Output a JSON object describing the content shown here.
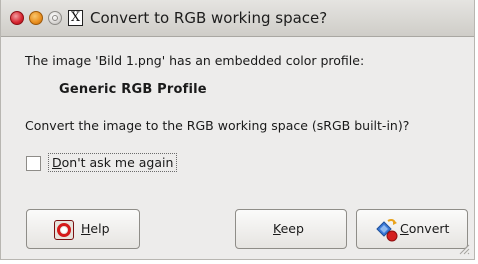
{
  "window": {
    "title": "Convert to RGB working space?",
    "app_icon_glyph": "X"
  },
  "message": {
    "line1": "The image 'Bild 1.png' has an embedded color profile:",
    "profile_name": "Generic RGB Profile",
    "question": "Convert the image to the RGB working space (sRGB built-in)?"
  },
  "checkbox": {
    "label_mnemonic": "D",
    "label_rest": "on't ask me again",
    "checked": false
  },
  "buttons": {
    "help": {
      "mnemonic": "H",
      "rest": "elp",
      "icon": "lifebuoy-icon"
    },
    "keep": {
      "mnemonic": "K",
      "rest": "eep"
    },
    "convert": {
      "mnemonic": "C",
      "rest": "onvert",
      "icon": "color-convert-icon"
    }
  },
  "colors": {
    "dialog_bg": "#edeceb",
    "close": "#d7252f",
    "minimize": "#e98e1e"
  }
}
